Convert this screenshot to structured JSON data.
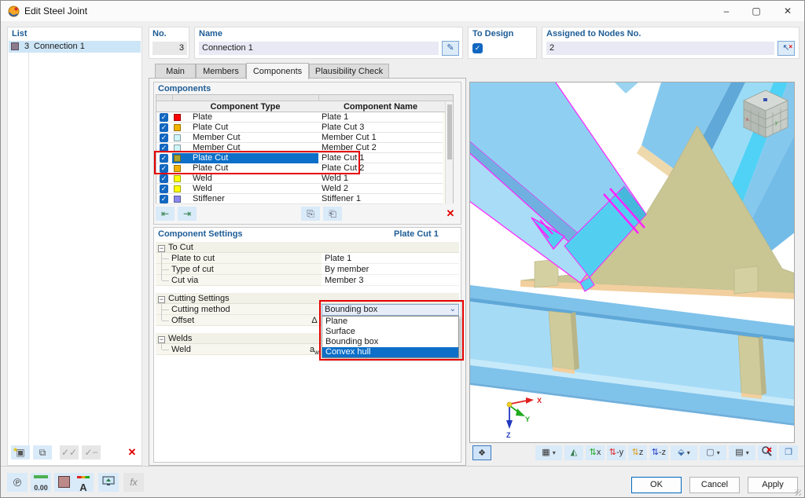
{
  "window": {
    "title": "Edit Steel Joint"
  },
  "list_panel": {
    "label": "List",
    "item_no": "3",
    "item_name": "Connection 1"
  },
  "header": {
    "no_label": "No.",
    "no_value": "3",
    "name_label": "Name",
    "name_value": "Connection 1",
    "to_design_label": "To Design",
    "assigned_label": "Assigned to Nodes No.",
    "assigned_value": "2"
  },
  "tabs": {
    "items": [
      "Main",
      "Members",
      "Components",
      "Plausibility Check"
    ],
    "active": "Components"
  },
  "components": {
    "group_label": "Components",
    "columns": [
      "Component Type",
      "Component Name"
    ],
    "rows": [
      {
        "checked": true,
        "color": "#fb0207",
        "type": "Plate",
        "name": "Plate 1"
      },
      {
        "checked": true,
        "color": "#f2b200",
        "type": "Plate Cut",
        "name": "Plate Cut 3"
      },
      {
        "checked": true,
        "color": "#cff5f9",
        "type": "Member Cut",
        "name": "Member Cut 1"
      },
      {
        "checked": true,
        "color": "#cff5f9",
        "type": "Member Cut",
        "name": "Member Cut 2"
      },
      {
        "checked": true,
        "color": "#aba42f",
        "type": "Plate Cut",
        "name": "Plate Cut 1",
        "selected": true
      },
      {
        "checked": true,
        "color": "#f2b200",
        "type": "Plate Cut",
        "name": "Plate Cut 2"
      },
      {
        "checked": true,
        "color": "#fdff00",
        "type": "Weld",
        "name": "Weld 1"
      },
      {
        "checked": true,
        "color": "#fdff00",
        "type": "Weld",
        "name": "Weld 2"
      },
      {
        "checked": true,
        "color": "#8a8aee",
        "type": "Stiffener",
        "name": "Stiffener 1"
      }
    ],
    "selection_color": "#0d6fc8"
  },
  "settings": {
    "group_label": "Component Settings",
    "selected_component": "Plate Cut 1",
    "groups": [
      {
        "label": "To Cut",
        "rows": [
          {
            "label": "Plate to cut",
            "value": "Plate 1"
          },
          {
            "label": "Type of cut",
            "value": "By member"
          },
          {
            "label": "Cut via",
            "value": "Member 3"
          }
        ]
      },
      {
        "label": "Cutting Settings",
        "rows": [
          {
            "label": "Cutting method",
            "value": "Bounding box"
          },
          {
            "label": "Offset",
            "symbol": "Δ"
          }
        ]
      },
      {
        "label": "Welds",
        "rows": [
          {
            "label": "Weld",
            "symbol_base": "a",
            "symbol_sub": "w"
          }
        ]
      }
    ],
    "dropdown": {
      "value": "Bounding box",
      "options": [
        "Plane",
        "Surface",
        "Bounding box",
        "Convex hull"
      ],
      "highlighted": "Convex hull"
    }
  },
  "viewport": {
    "axes": {
      "x": "X",
      "y": "Y",
      "z": "Z"
    },
    "toolbar_axis_labels": [
      "x",
      "-y",
      "z",
      "-z"
    ]
  },
  "buttons": {
    "ok": "OK",
    "cancel": "Cancel",
    "apply": "Apply"
  },
  "annotations": {
    "color": "#e60000"
  },
  "icons": {
    "minimize": "–",
    "maximize": "▢",
    "close": "✕",
    "check": "✓",
    "edit": "✎",
    "pick": "↖",
    "delete": "✕",
    "chevron_down": "⌄",
    "minus": "−",
    "pin": "℗",
    "decimals": "0.00",
    "fx": "fx"
  }
}
